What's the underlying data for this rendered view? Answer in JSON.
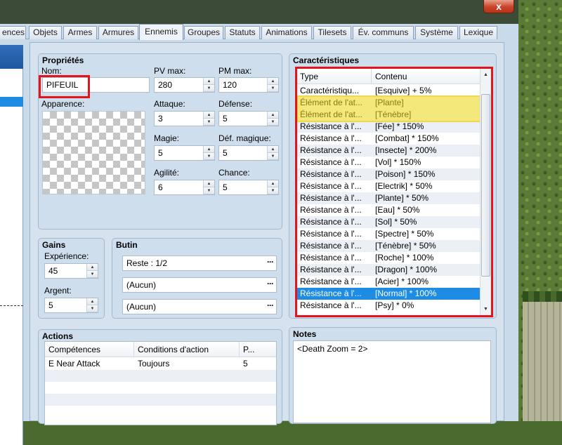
{
  "window": {
    "close_label": "x"
  },
  "tabs": [
    {
      "label": "ences",
      "active": false
    },
    {
      "label": "Objets",
      "active": false
    },
    {
      "label": "Armes",
      "active": false
    },
    {
      "label": "Armures",
      "active": false
    },
    {
      "label": "Ennemis",
      "active": true
    },
    {
      "label": "Groupes",
      "active": false
    },
    {
      "label": "Statuts",
      "active": false
    },
    {
      "label": "Animations",
      "active": false
    },
    {
      "label": "Tilesets",
      "active": false
    },
    {
      "label": "Év. communs",
      "active": false
    },
    {
      "label": "Système",
      "active": false
    },
    {
      "label": "Lexique",
      "active": false
    }
  ],
  "properties": {
    "title": "Propriétés",
    "name_label": "Nom:",
    "name_value": "PIFEUIL",
    "appearance_label": "Apparence:",
    "hp_label": "PV max:",
    "hp_value": "280",
    "mp_label": "PM max:",
    "mp_value": "120",
    "atk_label": "Attaque:",
    "atk_value": "3",
    "def_label": "Défense:",
    "def_value": "5",
    "mag_label": "Magie:",
    "mag_value": "5",
    "mdef_label": "Déf. magique:",
    "mdef_value": "5",
    "agi_label": "Agilité:",
    "agi_value": "6",
    "luk_label": "Chance:",
    "luk_value": "5"
  },
  "gains": {
    "title": "Gains",
    "exp_label": "Expérience:",
    "exp_value": "45",
    "gold_label": "Argent:",
    "gold_value": "5"
  },
  "loot": {
    "title": "Butin",
    "items": [
      "Reste : 1/2",
      "(Aucun)",
      "(Aucun)"
    ]
  },
  "actions": {
    "title": "Actions",
    "columns": [
      "Compétences",
      "Conditions d'action",
      "P..."
    ],
    "rows": [
      {
        "skill": "E Near Attack",
        "condition": "Toujours",
        "priority": "5"
      }
    ]
  },
  "traits": {
    "title": "Caractéristiques",
    "columns": [
      "Type",
      "Contenu"
    ],
    "rows": [
      {
        "type": "Caractéristiqu...",
        "content": "[Esquive] + 5%"
      },
      {
        "type": "Élément de l'at...",
        "content": "[Plante]"
      },
      {
        "type": "Élément de l'at...",
        "content": "[Ténèbre]"
      },
      {
        "type": "Résistance à l'...",
        "content": "[Fée] * 150%"
      },
      {
        "type": "Résistance à l'...",
        "content": "[Combat] * 150%"
      },
      {
        "type": "Résistance à l'...",
        "content": "[Insecte] * 200%"
      },
      {
        "type": "Résistance à l'...",
        "content": "[Vol] * 150%"
      },
      {
        "type": "Résistance à l'...",
        "content": "[Poison] * 150%"
      },
      {
        "type": "Résistance à l'...",
        "content": "[Electrik] * 50%"
      },
      {
        "type": "Résistance à l'...",
        "content": "[Plante] * 50%"
      },
      {
        "type": "Résistance à l'...",
        "content": "[Eau] * 50%"
      },
      {
        "type": "Résistance à l'...",
        "content": "[Sol] * 50%"
      },
      {
        "type": "Résistance à l'...",
        "content": "[Spectre] * 50%"
      },
      {
        "type": "Résistance à l'...",
        "content": "[Ténèbre] * 50%"
      },
      {
        "type": "Résistance à l'...",
        "content": "[Roche] * 100%"
      },
      {
        "type": "Résistance à l'...",
        "content": "[Dragon] * 100%"
      },
      {
        "type": "Résistance à l'...",
        "content": "[Acier] * 100%"
      },
      {
        "type": "Résistance à l'...",
        "content": "[Normal] * 100%"
      },
      {
        "type": "Résistance à l'...",
        "content": "[Psy] * 0%"
      }
    ]
  },
  "notes": {
    "title": "Notes",
    "text": "<Death Zoom = 2>"
  },
  "colors": {
    "accent_red": "#e3141c",
    "highlight_yellow": "#f5e87a",
    "selection_blue": "#1e8ce4"
  }
}
